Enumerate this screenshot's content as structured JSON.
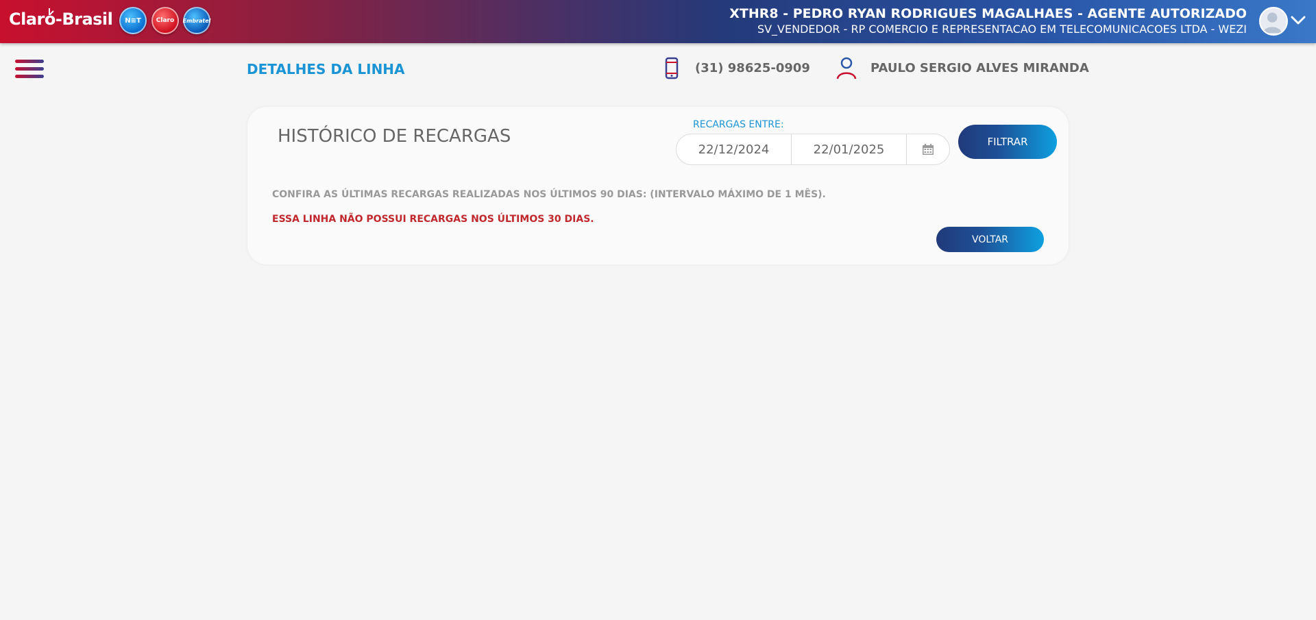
{
  "header": {
    "brand": "Claro-Brasil",
    "logos": {
      "net": "N≡T",
      "claro": "Claro",
      "embratel": "Embratel"
    },
    "user_line1": "XTHR8 - PEDRO RYAN RODRIGUES MAGALHAES - AGENTE AUTORIZADO",
    "user_line2": "SV_VENDEDOR - RP COMERCIO E REPRESENTACAO EM TELECOMUNICACOES LTDA - WEZI"
  },
  "subheader": {
    "title": "DETALHES DA LINHA",
    "phone": "(31) 98625-0909",
    "customer_name": "PAULO SERGIO ALVES MIRANDA"
  },
  "card": {
    "title": "HISTÓRICO DE RECARGAS",
    "range_label": "RECARGAS ENTRE:",
    "date_start": "22/12/2024",
    "date_end": "22/01/2025",
    "filter_label": "FILTRAR",
    "info_text": "CONFIRA AS ÚLTIMAS RECARGAS REALIZADAS NOS ÚLTIMOS 90 DIAS: (INTERVALO MÁXIMO DE 1 MÊS).",
    "warning_text": "ESSA LINHA NÃO POSSUI RECARGAS NOS ÚLTIMOS 30 DIAS.",
    "back_label": "VOLTAR"
  },
  "colors": {
    "accent_blue": "#1a94d4",
    "warning_red": "#c0282d",
    "brand_red": "#c8102e",
    "brand_navy": "#213a7a"
  },
  "icons": [
    "menu-icon",
    "phone-icon",
    "person-icon",
    "calendar-icon",
    "avatar-icon",
    "chevron-down-icon"
  ]
}
